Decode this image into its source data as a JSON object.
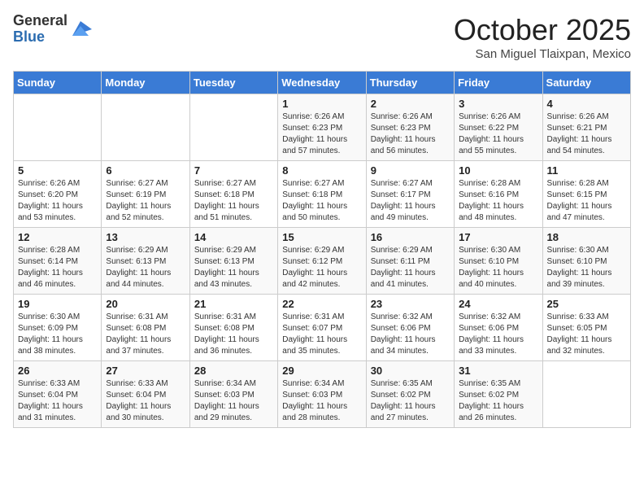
{
  "logo": {
    "general": "General",
    "blue": "Blue"
  },
  "title": "October 2025",
  "subtitle": "San Miguel Tlaixpan, Mexico",
  "days_of_week": [
    "Sunday",
    "Monday",
    "Tuesday",
    "Wednesday",
    "Thursday",
    "Friday",
    "Saturday"
  ],
  "weeks": [
    [
      {
        "day": "",
        "info": ""
      },
      {
        "day": "",
        "info": ""
      },
      {
        "day": "",
        "info": ""
      },
      {
        "day": "1",
        "info": "Sunrise: 6:26 AM\nSunset: 6:23 PM\nDaylight: 11 hours\nand 57 minutes."
      },
      {
        "day": "2",
        "info": "Sunrise: 6:26 AM\nSunset: 6:23 PM\nDaylight: 11 hours\nand 56 minutes."
      },
      {
        "day": "3",
        "info": "Sunrise: 6:26 AM\nSunset: 6:22 PM\nDaylight: 11 hours\nand 55 minutes."
      },
      {
        "day": "4",
        "info": "Sunrise: 6:26 AM\nSunset: 6:21 PM\nDaylight: 11 hours\nand 54 minutes."
      }
    ],
    [
      {
        "day": "5",
        "info": "Sunrise: 6:26 AM\nSunset: 6:20 PM\nDaylight: 11 hours\nand 53 minutes."
      },
      {
        "day": "6",
        "info": "Sunrise: 6:27 AM\nSunset: 6:19 PM\nDaylight: 11 hours\nand 52 minutes."
      },
      {
        "day": "7",
        "info": "Sunrise: 6:27 AM\nSunset: 6:18 PM\nDaylight: 11 hours\nand 51 minutes."
      },
      {
        "day": "8",
        "info": "Sunrise: 6:27 AM\nSunset: 6:18 PM\nDaylight: 11 hours\nand 50 minutes."
      },
      {
        "day": "9",
        "info": "Sunrise: 6:27 AM\nSunset: 6:17 PM\nDaylight: 11 hours\nand 49 minutes."
      },
      {
        "day": "10",
        "info": "Sunrise: 6:28 AM\nSunset: 6:16 PM\nDaylight: 11 hours\nand 48 minutes."
      },
      {
        "day": "11",
        "info": "Sunrise: 6:28 AM\nSunset: 6:15 PM\nDaylight: 11 hours\nand 47 minutes."
      }
    ],
    [
      {
        "day": "12",
        "info": "Sunrise: 6:28 AM\nSunset: 6:14 PM\nDaylight: 11 hours\nand 46 minutes."
      },
      {
        "day": "13",
        "info": "Sunrise: 6:29 AM\nSunset: 6:13 PM\nDaylight: 11 hours\nand 44 minutes."
      },
      {
        "day": "14",
        "info": "Sunrise: 6:29 AM\nSunset: 6:13 PM\nDaylight: 11 hours\nand 43 minutes."
      },
      {
        "day": "15",
        "info": "Sunrise: 6:29 AM\nSunset: 6:12 PM\nDaylight: 11 hours\nand 42 minutes."
      },
      {
        "day": "16",
        "info": "Sunrise: 6:29 AM\nSunset: 6:11 PM\nDaylight: 11 hours\nand 41 minutes."
      },
      {
        "day": "17",
        "info": "Sunrise: 6:30 AM\nSunset: 6:10 PM\nDaylight: 11 hours\nand 40 minutes."
      },
      {
        "day": "18",
        "info": "Sunrise: 6:30 AM\nSunset: 6:10 PM\nDaylight: 11 hours\nand 39 minutes."
      }
    ],
    [
      {
        "day": "19",
        "info": "Sunrise: 6:30 AM\nSunset: 6:09 PM\nDaylight: 11 hours\nand 38 minutes."
      },
      {
        "day": "20",
        "info": "Sunrise: 6:31 AM\nSunset: 6:08 PM\nDaylight: 11 hours\nand 37 minutes."
      },
      {
        "day": "21",
        "info": "Sunrise: 6:31 AM\nSunset: 6:08 PM\nDaylight: 11 hours\nand 36 minutes."
      },
      {
        "day": "22",
        "info": "Sunrise: 6:31 AM\nSunset: 6:07 PM\nDaylight: 11 hours\nand 35 minutes."
      },
      {
        "day": "23",
        "info": "Sunrise: 6:32 AM\nSunset: 6:06 PM\nDaylight: 11 hours\nand 34 minutes."
      },
      {
        "day": "24",
        "info": "Sunrise: 6:32 AM\nSunset: 6:06 PM\nDaylight: 11 hours\nand 33 minutes."
      },
      {
        "day": "25",
        "info": "Sunrise: 6:33 AM\nSunset: 6:05 PM\nDaylight: 11 hours\nand 32 minutes."
      }
    ],
    [
      {
        "day": "26",
        "info": "Sunrise: 6:33 AM\nSunset: 6:04 PM\nDaylight: 11 hours\nand 31 minutes."
      },
      {
        "day": "27",
        "info": "Sunrise: 6:33 AM\nSunset: 6:04 PM\nDaylight: 11 hours\nand 30 minutes."
      },
      {
        "day": "28",
        "info": "Sunrise: 6:34 AM\nSunset: 6:03 PM\nDaylight: 11 hours\nand 29 minutes."
      },
      {
        "day": "29",
        "info": "Sunrise: 6:34 AM\nSunset: 6:03 PM\nDaylight: 11 hours\nand 28 minutes."
      },
      {
        "day": "30",
        "info": "Sunrise: 6:35 AM\nSunset: 6:02 PM\nDaylight: 11 hours\nand 27 minutes."
      },
      {
        "day": "31",
        "info": "Sunrise: 6:35 AM\nSunset: 6:02 PM\nDaylight: 11 hours\nand 26 minutes."
      },
      {
        "day": "",
        "info": ""
      }
    ]
  ]
}
